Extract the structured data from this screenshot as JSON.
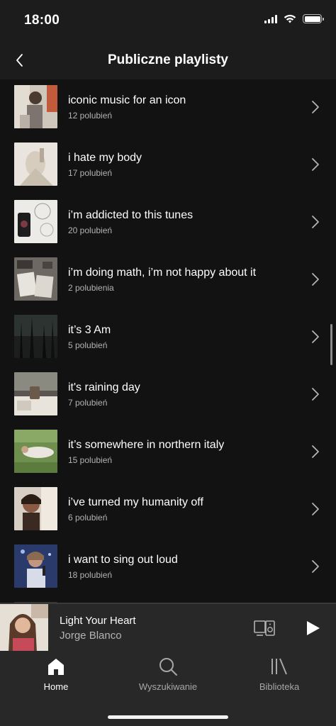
{
  "status_bar": {
    "time": "18:00"
  },
  "header": {
    "title": "Publiczne playlisty"
  },
  "playlists": [
    {
      "title": "iconic music for an icon",
      "likes": "12 polubień"
    },
    {
      "title": "i hate my body",
      "likes": "17 polubień"
    },
    {
      "title": "i’m addicted to this tunes",
      "likes": "20 polubień"
    },
    {
      "title": "i’m doing math, i’m not happy about it",
      "likes": "2 polubienia"
    },
    {
      "title": "it’s 3 Am",
      "likes": "5 polubień"
    },
    {
      "title": "it's raining day",
      "likes": "7 polubień"
    },
    {
      "title": "it’s somewhere in northern italy",
      "likes": "15 polubień"
    },
    {
      "title": "i’ve turned my humanity off",
      "likes": "6 polubień"
    },
    {
      "title": "i want to sing out loud",
      "likes": "18 polubień"
    }
  ],
  "now_playing": {
    "title": "Light Your Heart",
    "artist": "Jorge Blanco"
  },
  "tab_bar": {
    "tabs": [
      {
        "label": "Home",
        "icon": "home-icon",
        "active": true
      },
      {
        "label": "Wyszukiwanie",
        "icon": "search-icon",
        "active": false
      },
      {
        "label": "Biblioteka",
        "icon": "library-icon",
        "active": false
      }
    ]
  },
  "colors": {
    "background": "#121212",
    "header": "#1c1c1c",
    "player": "#282828",
    "secondary_text": "#b3b3b3"
  }
}
